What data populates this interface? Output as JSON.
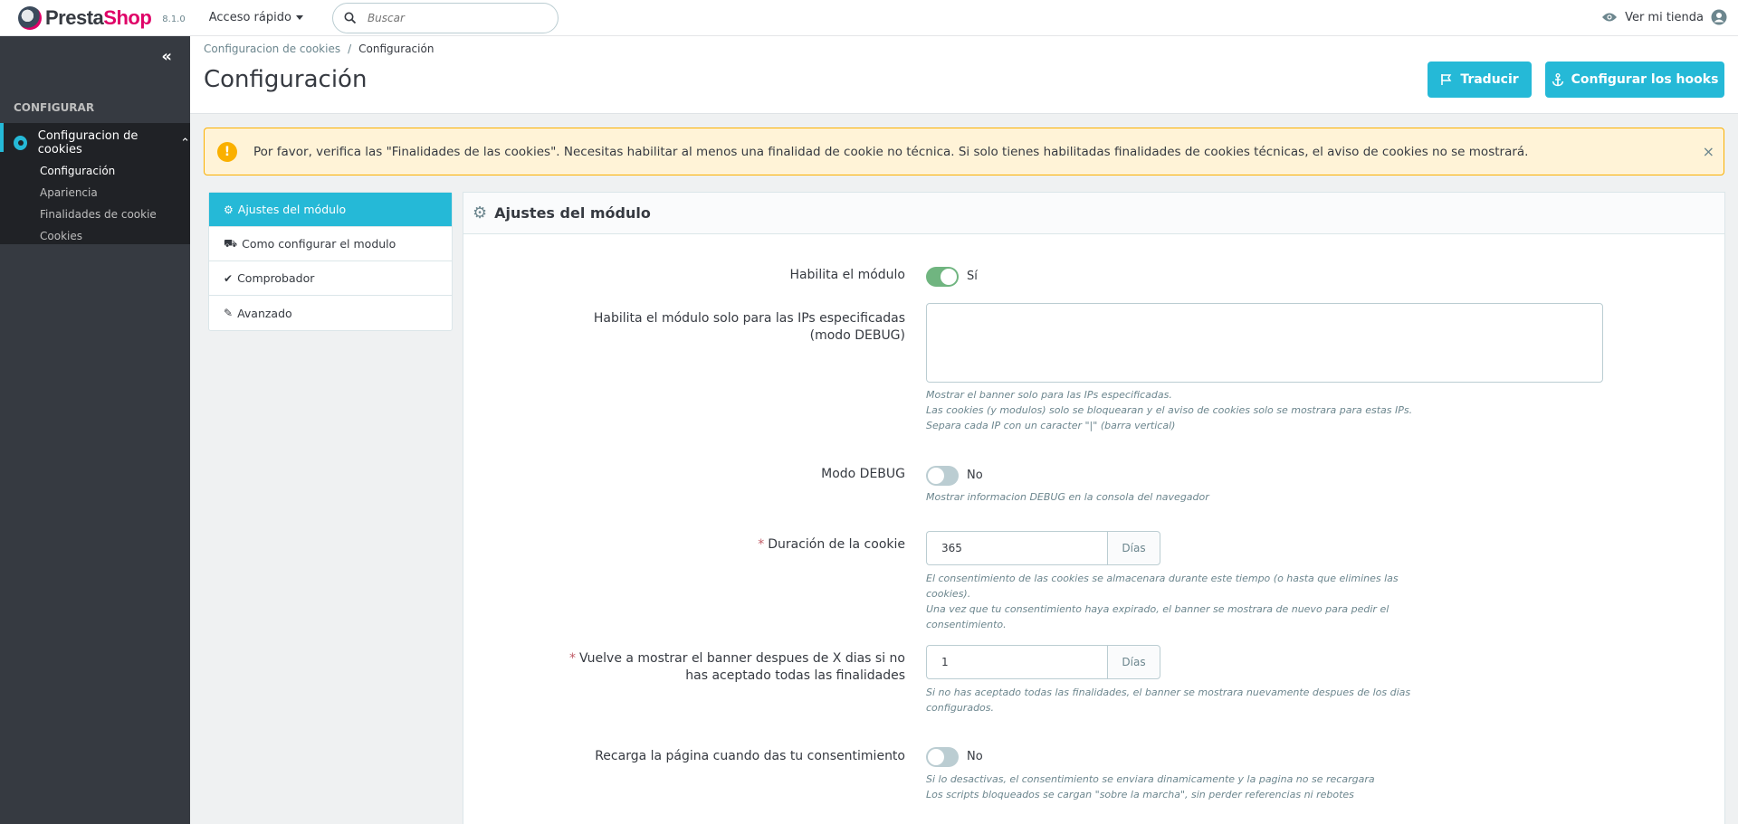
{
  "header": {
    "logo_main": "Presta",
    "logo_accent": "Shop",
    "version": "8.1.0",
    "quick_access": "Acceso rápido",
    "search_placeholder": "Buscar",
    "view_shop": "Ver mi tienda"
  },
  "sidebar": {
    "collapse_glyph": "«",
    "section": "CONFIGURAR",
    "active_item": "Configuracion de cookies",
    "chevron_glyph": "⌃",
    "subitems": [
      "Configuración",
      "Apariencia",
      "Finalidades de cookie",
      "Cookies"
    ]
  },
  "page": {
    "breadcrumb": [
      "Configuracion de cookies",
      "Configuración"
    ],
    "breadcrumb_sep": "/",
    "title": "Configuración",
    "btn_translate": "Traducir",
    "btn_hooks": "Configurar los hooks"
  },
  "alert": {
    "icon": "!",
    "text": "Por favor, verifica las \"Finalidades de las cookies\". Necesitas habilitar al menos una finalidad de cookie no técnica. Si solo tienes habilitadas finalidades de cookies técnicas, el aviso de cookies no se mostrará.",
    "close": "×"
  },
  "tabs": [
    {
      "label": "Ajustes del módulo",
      "icon": "gears-icon",
      "glyph": "⚙"
    },
    {
      "label": "Como configurar el modulo",
      "icon": "truck-icon",
      "glyph": "⛟"
    },
    {
      "label": "Comprobador",
      "icon": "check-icon",
      "glyph": "✔"
    },
    {
      "label": "Avanzado",
      "icon": "wand-icon",
      "glyph": "✎"
    }
  ],
  "panel": {
    "title": "Ajustes del módulo",
    "fields": {
      "enable": {
        "label": "Habilita el módulo",
        "value": "Sí",
        "on": true
      },
      "ips": {
        "label": "Habilita el módulo solo para las IPs especificadas (modo DEBUG)",
        "value": "",
        "help": [
          "Mostrar el banner solo para las IPs especificadas.",
          "Las cookies (y modulos) solo se bloquearan y el aviso de cookies solo se mostrara para estas IPs.",
          "Separa cada IP con un caracter \"|\" (barra vertical)"
        ]
      },
      "debug": {
        "label": "Modo DEBUG",
        "value": "No",
        "on": false,
        "help": "Mostrar informacion DEBUG en la consola del navegador"
      },
      "duration": {
        "required": "*",
        "label": "Duración de la cookie",
        "value": "365",
        "unit": "Días",
        "help": [
          "El consentimiento de las cookies se almacenara durante este tiempo (o hasta que elimines las cookies).",
          "Una vez que tu consentimiento haya expirado, el banner se mostrara de nuevo para pedir el",
          "consentimiento."
        ]
      },
      "reshow": {
        "required": "*",
        "label": "Vuelve a mostrar el banner despues de X dias si no has aceptado todas las finalidades",
        "value": "1",
        "unit": "Días",
        "help": [
          "Si no has aceptado todas las finalidades, el banner se mostrara nuevamente despues de los dias",
          "configurados."
        ]
      },
      "reload": {
        "label": "Recarga la página cuando das tu consentimiento",
        "value": "No",
        "on": false,
        "help": [
          "Si lo desactivas, el consentimiento se enviara dinamicamente y la pagina no se recargara",
          "Los scripts bloqueados se cargan \"sobre la marcha\", sin perder referencias ni rebotes"
        ]
      }
    }
  },
  "colors": {
    "primary": "#25b9d7",
    "sidebar": "#363a41",
    "switch_on": "#70b580",
    "warning": "#fab000",
    "brand": "#df0067"
  }
}
